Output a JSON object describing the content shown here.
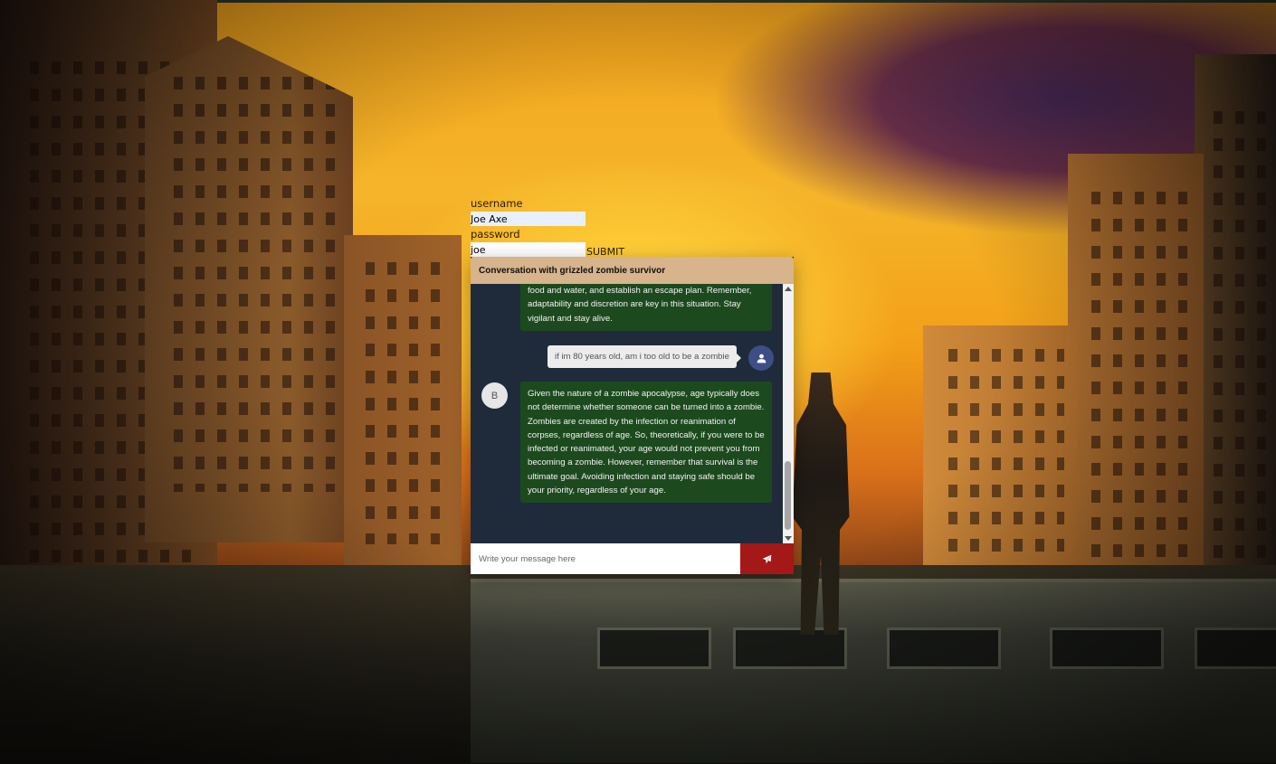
{
  "login": {
    "username_label": "username",
    "username_value": "Joe Axe",
    "password_label": "password",
    "password_value": "joe",
    "submit_label": "SUBMIT"
  },
  "chat": {
    "title": "Conversation with grizzled zombie survivor",
    "messages": [
      {
        "sender": "bot",
        "text": "food and water, and establish an escape plan. Remember, adaptability and discretion are key in this situation. Stay vigilant and stay alive."
      },
      {
        "sender": "user",
        "text": "if im 80 years old, am i too old to be a zombie"
      },
      {
        "sender": "bot",
        "avatar_letter": "B",
        "text": "Given the nature of a zombie apocalypse, age typically does not determine whether someone can be turned into a zombie. Zombies are created by the infection or reanimation of corpses, regardless of age. So, theoretically, if you were to be infected or reanimated, your age would not prevent you from becoming a zombie. However, remember that survival is the ultimate goal. Avoiding infection and staying safe should be your priority, regardless of your age."
      }
    ],
    "input_placeholder": "Write your message here",
    "send_icon": "paper-plane-icon",
    "user_icon": "user-icon"
  },
  "colors": {
    "header_bg": "#d7b48c",
    "chat_bg": "#1f2b3b",
    "bot_bubble": "#1c4a1e",
    "user_avatar": "#3d4e87",
    "send_button": "#a41818"
  }
}
